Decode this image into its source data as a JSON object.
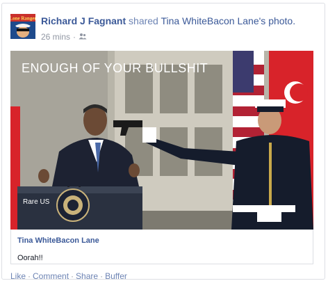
{
  "post": {
    "author": "Richard J Fagnant",
    "shared_text": "shared",
    "original_author": "Tina WhiteBacon Lane",
    "possessive": "'s",
    "object": "photo.",
    "time": "26 mins",
    "separator": "·",
    "audience_icon": "friends-icon"
  },
  "avatar": {
    "text": "Lone Ranger"
  },
  "photo": {
    "caption": "ENOUGH OF YOUR BULLSHIT",
    "watermark": "Rare US"
  },
  "shared_caption": {
    "name": "Tina WhiteBacon Lane",
    "text": "Oorah!!"
  },
  "actions": {
    "like": "Like",
    "comment": "Comment",
    "share": "Share",
    "buffer": "Buffer",
    "separator": "·"
  },
  "colors": {
    "link": "#3b5998",
    "muted": "#9197a3",
    "border": "#dcdee3"
  }
}
